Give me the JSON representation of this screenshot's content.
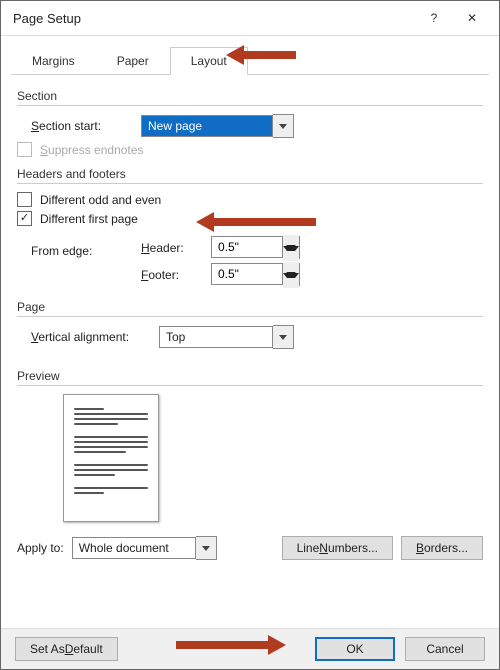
{
  "titlebar": {
    "title": "Page Setup",
    "help": "?",
    "close": "✕"
  },
  "tabs": {
    "margins": "Margins",
    "paper": "Paper",
    "layout": "Layout"
  },
  "section": {
    "heading": "Section",
    "start_label": "Section start:",
    "start_value": "New page",
    "suppress_label": "Suppress endnotes"
  },
  "headers": {
    "heading": "Headers and footers",
    "odd_even_label": "Different odd and even",
    "first_page_label": "Different first page",
    "from_edge_label": "From edge:",
    "header_label": "Header:",
    "footer_label": "Footer:",
    "header_value": "0.5\"",
    "footer_value": "0.5\""
  },
  "page": {
    "heading": "Page",
    "valign_label": "Vertical alignment:",
    "valign_value": "Top"
  },
  "preview": {
    "heading": "Preview"
  },
  "apply": {
    "label": "Apply to:",
    "value": "Whole document"
  },
  "buttons": {
    "line_numbers": "Line Numbers...",
    "borders": "Borders...",
    "set_default": "Set As Default",
    "ok": "OK",
    "cancel": "Cancel"
  },
  "underline": {
    "section_start_prefix": "S",
    "section_start_rest": "ection start:",
    "suppress_prefix": "S",
    "suppress_rest": "uppress endnotes",
    "valign_prefix": "V",
    "valign_rest": "ertical alignment:",
    "header_prefix": "H",
    "header_rest": "eader:",
    "footer_prefix": "F",
    "footer_rest": "ooter:",
    "default_prefix": "D",
    "default_rest": "efault",
    "numbers_prefix": "N",
    "numbers_rest": "umbers...",
    "borders_prefix": "B",
    "borders_rest": "orders..."
  }
}
